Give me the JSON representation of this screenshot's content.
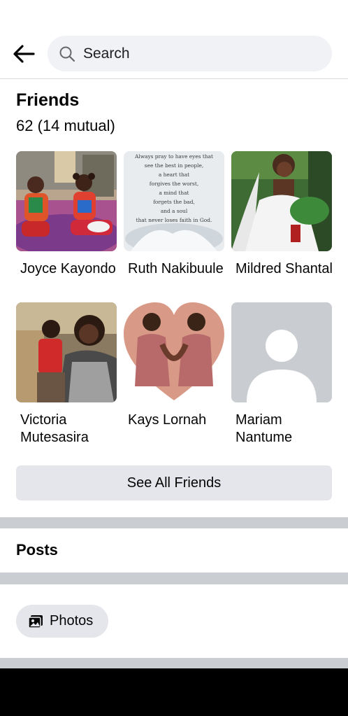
{
  "search": {
    "placeholder": "Search"
  },
  "friends": {
    "title": "Friends",
    "count": "62 (14 mutual)",
    "items": [
      {
        "name": "Joyce Kayondo",
        "photo": "two-children-photo"
      },
      {
        "name": "Ruth Nakibuule",
        "photo": "quote-image"
      },
      {
        "name": "Mildred Shantal",
        "photo": "bride-photo"
      },
      {
        "name": "Victoria Mutesasira",
        "photo": "woman-with-child-photo"
      },
      {
        "name": "Kays Lornah",
        "photo": "heart-collage-photo"
      },
      {
        "name": "Mariam Nantume",
        "photo": "default-avatar"
      }
    ],
    "quote_lines": [
      "Always pray to have eyes that",
      "see the best in people,",
      "a heart that",
      "forgives the worst,",
      "a mind that",
      "forgets the bad,",
      "and a soul",
      "that never loses faith in God."
    ],
    "see_all_label": "See All Friends"
  },
  "posts": {
    "title": "Posts"
  },
  "photos": {
    "label": "Photos"
  },
  "colors": {
    "background": "#ffffff",
    "search_bg": "#f0f2f5",
    "button_bg": "#e4e6eb",
    "divider": "#cacdd1",
    "text": "#050505"
  }
}
